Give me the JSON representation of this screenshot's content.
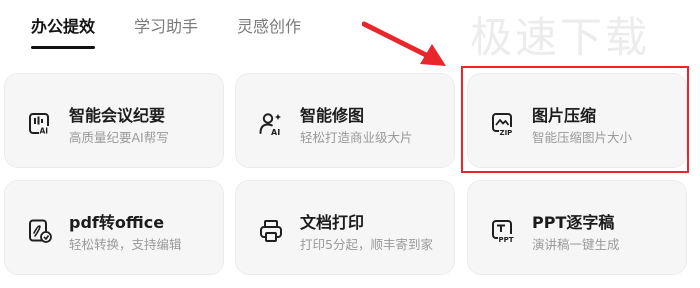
{
  "tabs": [
    {
      "label": "办公提效",
      "active": true
    },
    {
      "label": "学习助手",
      "active": false
    },
    {
      "label": "灵感创作",
      "active": false
    }
  ],
  "watermark": "极速下载",
  "cards": [
    {
      "title": "智能会议纪要",
      "subtitle": "高质量纪要AI帮写",
      "icon": "ai-meeting-icon"
    },
    {
      "title": "智能修图",
      "subtitle": "轻松打造商业级大片",
      "icon": "ai-person-edit-icon"
    },
    {
      "title": "图片压缩",
      "subtitle": "智能压缩图片大小",
      "icon": "image-zip-icon",
      "highlighted": true
    },
    {
      "title": "pdf转office",
      "subtitle": "轻松转换，支持编辑",
      "icon": "pdf-convert-icon"
    },
    {
      "title": "文档打印",
      "subtitle": "打印5分起，顺丰寄到家",
      "icon": "printer-icon"
    },
    {
      "title": "PPT逐字稿",
      "subtitle": "演讲稿一键生成",
      "icon": "ppt-script-icon"
    }
  ],
  "colors": {
    "highlight": "#e8262b",
    "card_bg": "#f6f6f7",
    "active_tab": "#141414"
  }
}
